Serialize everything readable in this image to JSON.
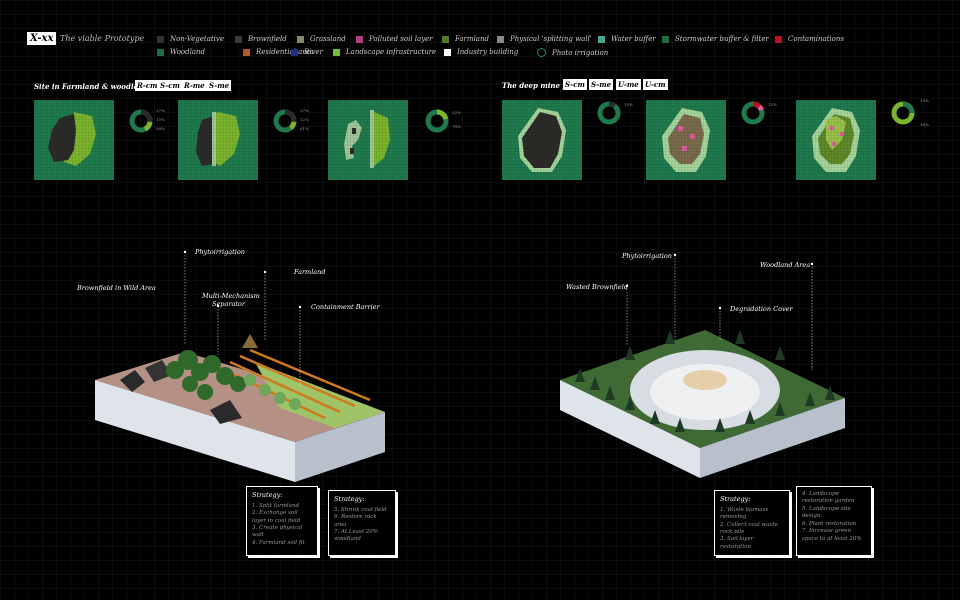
{
  "header": {
    "tag": "X-xx",
    "subtitle": "The viable Prototype"
  },
  "legend": [
    {
      "label": "Non-Vegetative",
      "color": "#333333"
    },
    {
      "label": "Brownfield",
      "color": "#3a3a3a"
    },
    {
      "label": "Grassland",
      "color": "#7d8f68"
    },
    {
      "label": "Polluted soil layer",
      "color": "#b0407a"
    },
    {
      "label": "Farmland",
      "color": "#4f7d22"
    },
    {
      "label": "Physical 'splitting wall'",
      "color": "#8a8a8a"
    },
    {
      "label": "Water buffer",
      "color": "#4aa593"
    },
    {
      "label": "Stormwater buffer & filter",
      "color": "#1f6e3e"
    },
    {
      "label": "Contaminations",
      "color": "#c0121b"
    },
    {
      "label": "Woodland",
      "color": "#1e6e45"
    },
    {
      "label": "Residential area",
      "color": "#b25a25"
    },
    {
      "label": "River",
      "color": "#1c2f86"
    },
    {
      "label": "Landscape infrastructure",
      "color": "#6fbf2f"
    },
    {
      "label": "Industry building",
      "color": "#ffffff"
    },
    {
      "label": "Photo irrigation",
      "color": "#1e6e45"
    }
  ],
  "left": {
    "title": "Site in Farmland & woodland",
    "tags": [
      "R-cm",
      "S-cm",
      "R-me",
      "S-me"
    ],
    "donut_labels": [
      [
        "27%",
        "15%",
        "58%"
      ],
      [
        "27%",
        "12%",
        "61%"
      ],
      [
        "22%",
        "78%"
      ]
    ],
    "annotations": {
      "phyto": "Phytoirrigation",
      "farmland": "Farmland",
      "brownfield": "Brownfield in Wild Area",
      "separator_1": "Multi-Mechanism",
      "separator_2": "Separator",
      "barrier": "Containment Barrier"
    },
    "strategy_a": {
      "heading": "Strategy:",
      "lines": [
        "1. Split farmland",
        "2. Exchange soil",
        "   layer in coal field",
        "3. Create physical",
        "   wall",
        "4. Farmland soil fit"
      ]
    },
    "strategy_b": {
      "heading": "Strategy:",
      "lines": [
        "5. Shrink coal field",
        "6. Restore rock",
        "   area",
        "7. At Least 20%",
        "   woodland"
      ]
    }
  },
  "right": {
    "title": "The deep mine pit",
    "tags": [
      "S-cm",
      "S-me",
      "U-me",
      "U-cm"
    ],
    "donut_labels": [
      [
        "10%"
      ],
      [
        "12%"
      ],
      [
        "13%",
        "16%"
      ]
    ],
    "annotations": {
      "phyto": "Phytoirrigation",
      "woodland": "Woodland Area",
      "wasted": "Wasted Brownfield",
      "degradation": "Degradation Cover"
    },
    "strategy_a": {
      "heading": "Strategy:",
      "lines": [
        "1. Waste biomass",
        "   removing",
        "2. Collect coal waste",
        "   rock pile",
        "3. Soil layer restoration"
      ]
    },
    "strategy_b": {
      "heading": "",
      "lines": [
        "4. Landscape",
        "   restoration garden",
        "5. Landscape site",
        "   design",
        "6. Plant restoration",
        "7. Increase green",
        "   space to at least 20%"
      ]
    }
  }
}
